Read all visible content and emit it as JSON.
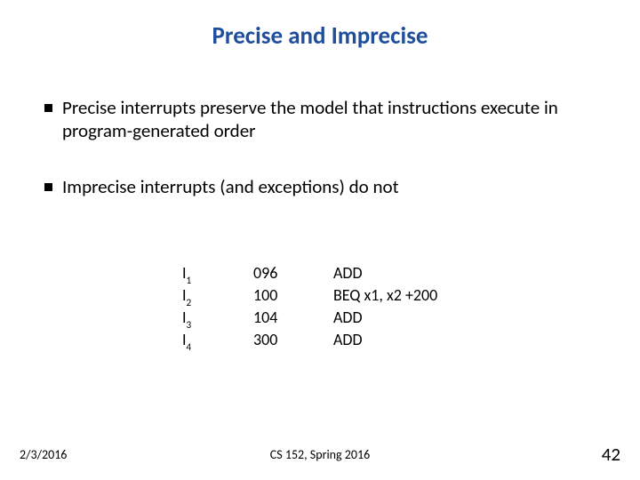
{
  "title": "Precise and Imprecise",
  "bullets": {
    "b1": "Precise interrupts preserve the model that instructions execute in program-generated order",
    "b2": "Imprecise interrupts (and exceptions) do not"
  },
  "instr": {
    "labelPrefix": "I",
    "rows": [
      {
        "idx": "1",
        "addr": "096",
        "op": "ADD"
      },
      {
        "idx": "2",
        "addr": "100",
        "op": "BEQ x1, x2 +200"
      },
      {
        "idx": "3",
        "addr": "104",
        "op": "ADD"
      },
      {
        "idx": "4",
        "addr": "300",
        "op": "ADD"
      }
    ]
  },
  "footer": {
    "date": "2/3/2016",
    "center": "CS 152, Spring 2016",
    "page": "42"
  }
}
